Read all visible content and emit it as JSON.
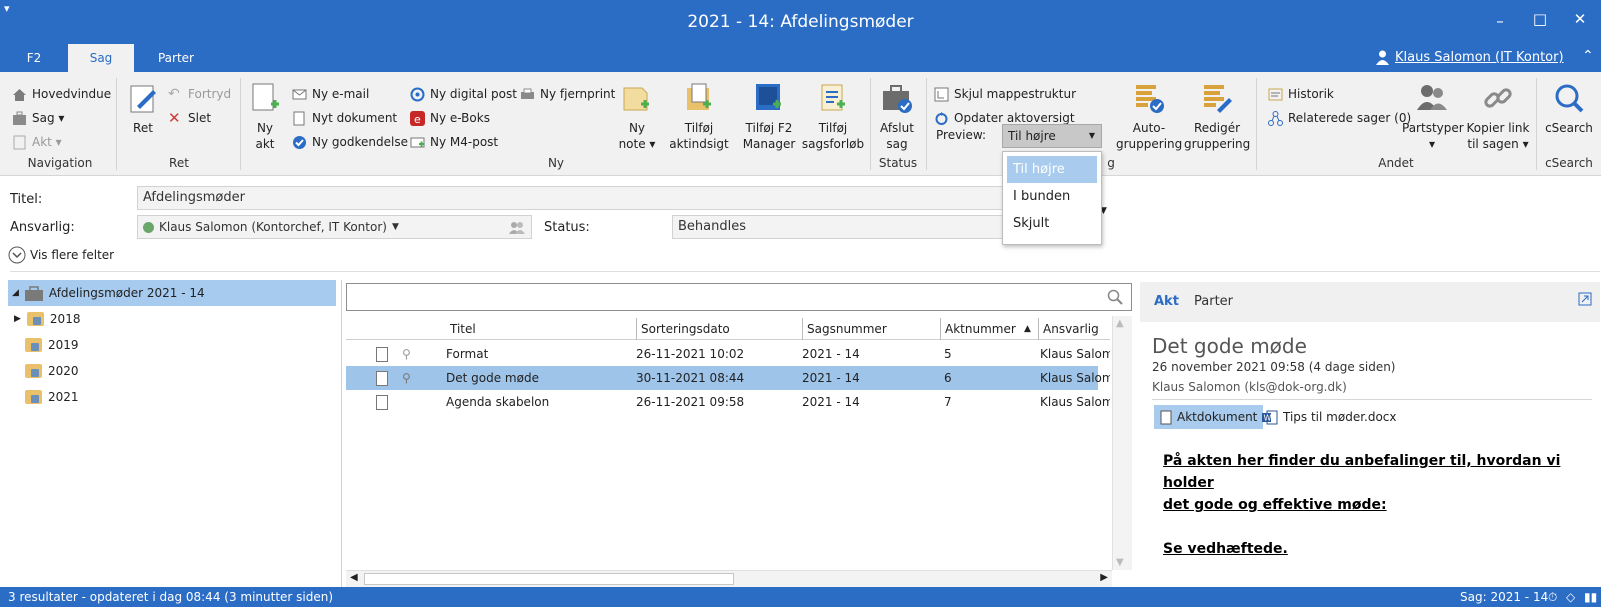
{
  "window": {
    "title": "2021 - 14: Afdelingsmøder",
    "minimize": "–",
    "maximize": "□",
    "close": "✕",
    "menu_glyph": "▾"
  },
  "tabs": [
    {
      "label": "F2"
    },
    {
      "label": "Sag"
    },
    {
      "label": "Parter"
    }
  ],
  "user": {
    "name": "Klaus Salomon (IT Kontor)"
  },
  "ribbon": {
    "navigation": {
      "group_label": "Navigation",
      "items": [
        {
          "label": "Hovedvindue"
        },
        {
          "label": "Sag ▾"
        },
        {
          "label": "Akt ▾"
        }
      ]
    },
    "ret": {
      "group_label": "Ret",
      "big": {
        "label": "Ret"
      },
      "items": [
        {
          "label": "Fortryd"
        },
        {
          "label": "Slet"
        }
      ]
    },
    "ny": {
      "group_label": "Ny",
      "big": {
        "line1": "Ny",
        "line2": "akt"
      },
      "col1": [
        {
          "label": "Ny e-mail"
        },
        {
          "label": "Nyt dokument"
        },
        {
          "label": "Ny godkendelse"
        }
      ],
      "col2": [
        {
          "label": "Ny digital post"
        },
        {
          "label": "Ny e-Boks"
        },
        {
          "label": "Ny M4-post"
        }
      ],
      "col3": [
        {
          "label": "Ny fjernprint"
        }
      ],
      "bigs": [
        {
          "line1": "Ny",
          "line2": "note ▾"
        },
        {
          "line1": "Tilføj",
          "line2": "aktindsigt"
        },
        {
          "line1": "Tilføj F2",
          "line2": "Manager"
        },
        {
          "line1": "Tilføj",
          "line2": "sagsforløb"
        }
      ]
    },
    "status": {
      "group_label": "Status",
      "big": {
        "line1": "Afslut",
        "line2": "sag"
      }
    },
    "visning": {
      "group_label_fragment": "g",
      "items": [
        {
          "label": "Skjul mappestruktur"
        },
        {
          "label": "Opdater aktoversigt"
        }
      ],
      "preview_label": "Preview:",
      "preview_value": "Til højre",
      "bigs": [
        {
          "line1": "Auto-",
          "line2": "gruppering"
        },
        {
          "line1": "Redigér",
          "line2": "gruppering"
        }
      ]
    },
    "andet": {
      "group_label": "Andet",
      "items": [
        {
          "label": "Historik"
        },
        {
          "label": "Relaterede sager (0)"
        }
      ],
      "bigs": [
        {
          "line1": "Partstyper",
          "line2": "▾"
        },
        {
          "line1": "Kopier link",
          "line2": "til sagen ▾"
        }
      ]
    },
    "csearch": {
      "group_label": "cSearch",
      "big": {
        "label": "cSearch"
      }
    }
  },
  "fields": {
    "titel_label": "Titel:",
    "titel_value": "Afdelingsmøder",
    "ansvarlig_label": "Ansvarlig:",
    "ansvarlig_value": "Klaus Salomon (Kontorchef, IT Kontor)",
    "status_label": "Status:",
    "status_value": "Behandles",
    "more_fields": "Vis flere felter"
  },
  "tree": {
    "root": "Afdelingsmøder 2021 - 14",
    "children": [
      {
        "label": "2018"
      },
      {
        "label": "2019"
      },
      {
        "label": "2020"
      },
      {
        "label": "2021"
      }
    ]
  },
  "grid": {
    "search_placeholder": "",
    "headers": {
      "titel": "Titel",
      "sorteringsdato": "Sorteringsdato",
      "sagsnummer": "Sagsnummer",
      "aktnummer": "Aktnummer",
      "ansvarlig": "Ansvarlig"
    },
    "rows": [
      {
        "titel": "Format",
        "dato": "26-11-2021 10:02",
        "sag": "2021 - 14",
        "akt": "5",
        "ansvarlig": "Klaus Salomon"
      },
      {
        "titel": "Det gode møde",
        "dato": "30-11-2021 08:44",
        "sag": "2021 - 14",
        "akt": "6",
        "ansvarlig": "Klaus Salomon"
      },
      {
        "titel": "Agenda skabelon",
        "dato": "26-11-2021 09:58",
        "sag": "2021 - 14",
        "akt": "7",
        "ansvarlig": "Klaus Salomon"
      }
    ]
  },
  "dropdown": {
    "options": [
      {
        "label": "Til højre"
      },
      {
        "label": "I bunden"
      },
      {
        "label": "Skjult"
      }
    ]
  },
  "preview": {
    "tabs": [
      {
        "label": "Akt"
      },
      {
        "label": "Parter"
      }
    ],
    "title": "Det gode møde",
    "date": "26 november 2021 09:58 (4 dage siden)",
    "author": "Klaus Salomon (kls@dok-org.dk)",
    "doc_tabs": [
      {
        "label": "Aktdokument"
      },
      {
        "label": "Tips til møder.docx"
      }
    ],
    "body_line1": "På akten her finder du anbefalinger til, hvordan vi holder",
    "body_line2": "det gode og effektive møde:",
    "body_line3": "Se vedhæftede."
  },
  "statusbar": {
    "left": "3 resultater - opdateret i dag 08:44 (3 minutter siden)",
    "right": "Sag: 2021 - 14"
  },
  "colors": {
    "accent": "#2b6cc4",
    "selection": "#9ec4ea",
    "ribbon_bg": "#f1f1f1"
  }
}
